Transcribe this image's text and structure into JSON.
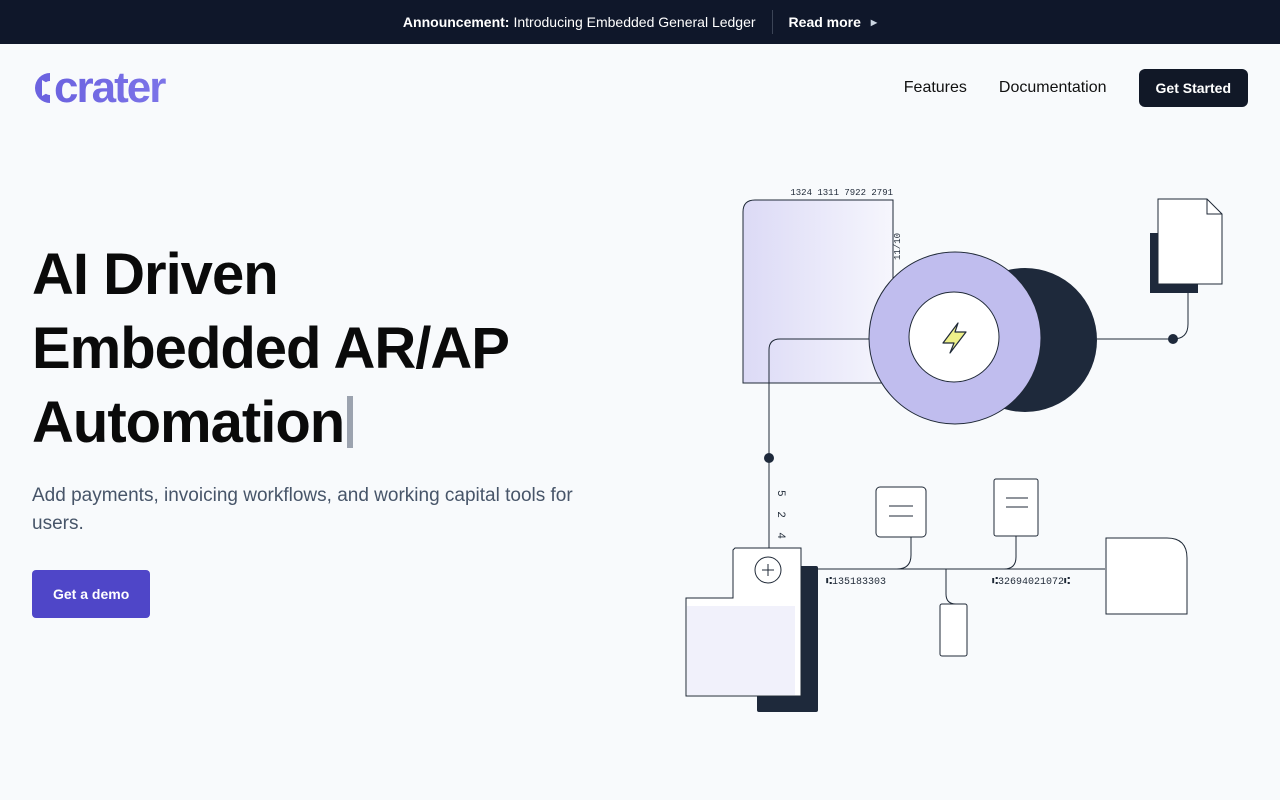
{
  "announcement": {
    "label": "Announcement:",
    "text": "Introducing Embedded General Ledger",
    "link": "Read more",
    "link_icon": "triangle-right-icon"
  },
  "header": {
    "logo_text": "crater",
    "nav": [
      "Features",
      "Documentation"
    ],
    "cta": "Get Started"
  },
  "hero": {
    "title_lines": [
      "AI Driven",
      "Embedded AR/AP",
      "Automation"
    ],
    "subtitle": "Add payments, invoicing workflows, and working capital tools for users.",
    "cta": "Get a demo"
  },
  "illustration": {
    "card_number": "1324 1311 7922 2791",
    "expiry": "11/10",
    "vertical_code": "5 2 4 2",
    "code_left": "⑆135183303",
    "code_right": "⑆32694021072⑆",
    "center_icon": "lightning-bolt-icon"
  },
  "colors": {
    "announcement_bg": "#0f172a",
    "brand": "#6c63e0",
    "primary_button": "#4f46c8",
    "dark_button": "#111827",
    "lavender": "#c0bdee",
    "background": "#f8fafc"
  }
}
